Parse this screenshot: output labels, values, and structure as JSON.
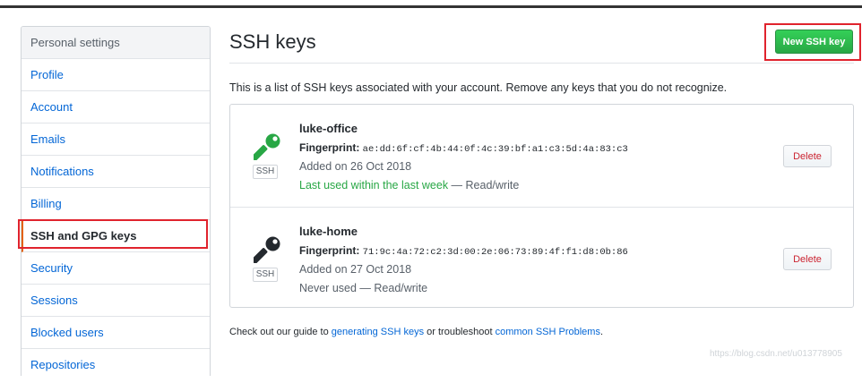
{
  "sidebar": {
    "header": "Personal settings",
    "items": [
      {
        "label": "Profile"
      },
      {
        "label": "Account"
      },
      {
        "label": "Emails"
      },
      {
        "label": "Notifications"
      },
      {
        "label": "Billing"
      },
      {
        "label": "SSH and GPG keys",
        "selected": true
      },
      {
        "label": "Security"
      },
      {
        "label": "Sessions"
      },
      {
        "label": "Blocked users"
      },
      {
        "label": "Repositories"
      }
    ]
  },
  "main": {
    "title": "SSH keys",
    "new_key_button": "New SSH key",
    "intro": "This is a list of SSH keys associated with your account. Remove any keys that you do not recognize.",
    "keys": [
      {
        "title": "luke-office",
        "fingerprint_label": "Fingerprint:",
        "fingerprint": "ae:dd:6f:cf:4b:44:0f:4c:39:bf:a1:c3:5d:4a:83:c3",
        "added": "Added on 26 Oct 2018",
        "usage": "Last used within the last week",
        "access": " — Read/write",
        "badge": "SSH",
        "delete_label": "Delete",
        "icon": "key-icon",
        "icon_color": "#28a745",
        "usage_color": "#28a745"
      },
      {
        "title": "luke-home",
        "fingerprint_label": "Fingerprint:",
        "fingerprint": "71:9c:4a:72:c2:3d:00:2e:06:73:89:4f:f1:d8:0b:86",
        "added": "Added on 27 Oct 2018",
        "usage": "Never used",
        "access": " — Read/write",
        "badge": "SSH",
        "delete_label": "Delete",
        "icon": "key-icon",
        "icon_color": "#24292e",
        "usage_color": "#586069"
      }
    ],
    "guide": {
      "prefix": "Check out our guide to ",
      "link1": "generating SSH keys",
      "middle": " or troubleshoot ",
      "link2": "common SSH Problems",
      "suffix": "."
    }
  },
  "watermark": "https://blog.csdn.net/u013778905",
  "colors": {
    "link": "#0366d6",
    "primary_button": "#28a745",
    "danger": "#cb2431",
    "highlight_box": "#e0232d"
  }
}
